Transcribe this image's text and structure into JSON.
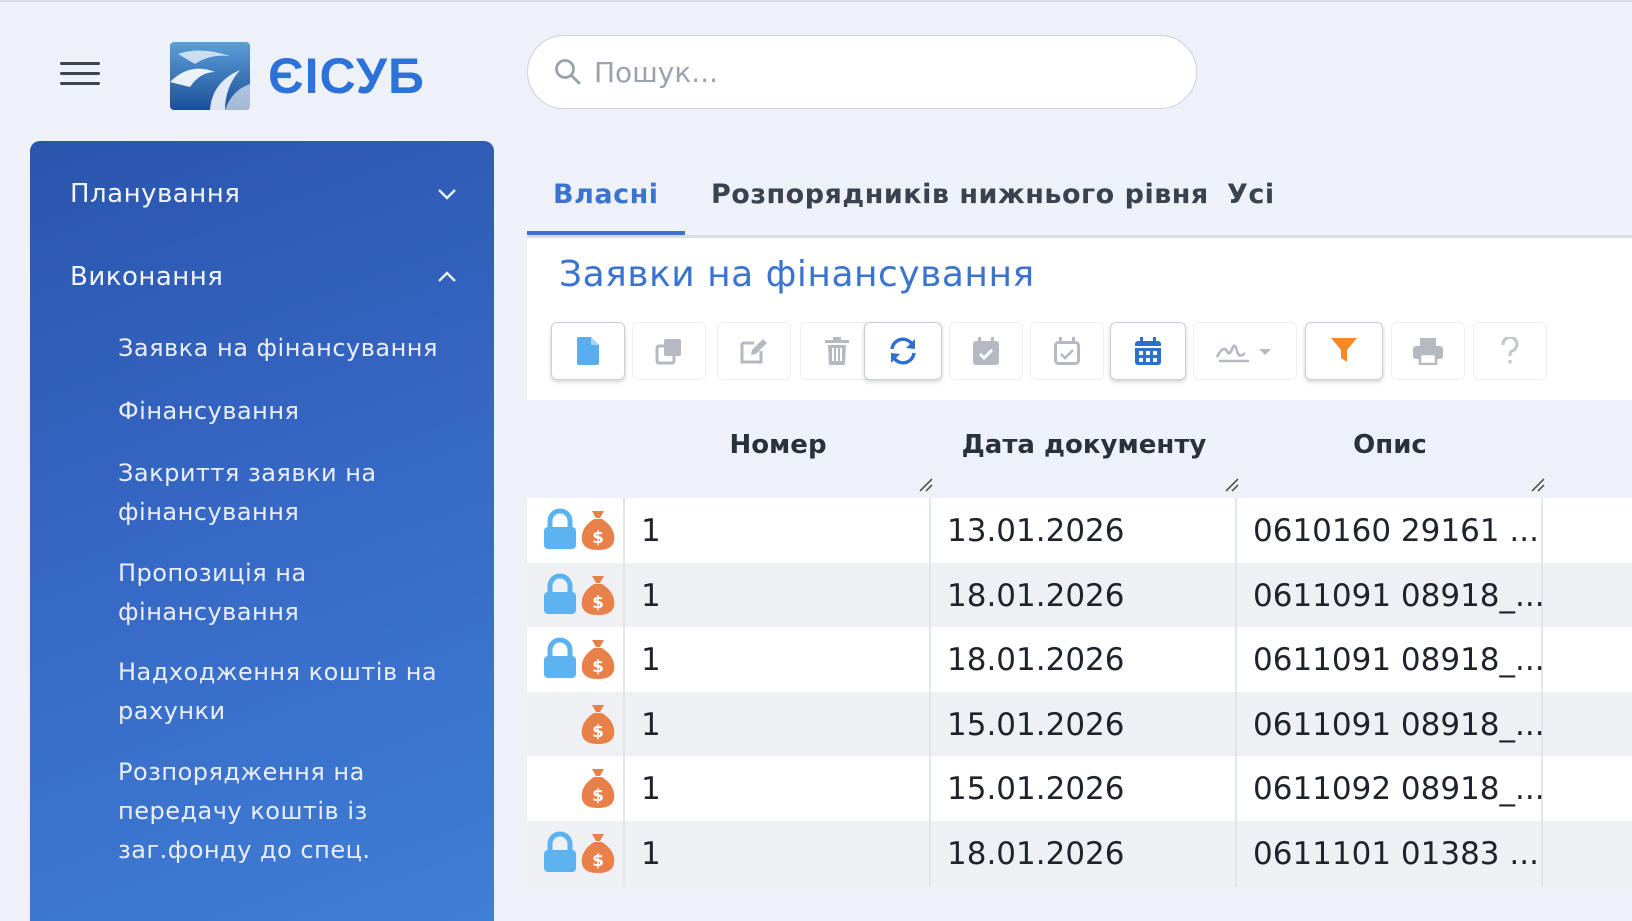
{
  "app": {
    "name": "ЄІСУБ"
  },
  "search": {
    "placeholder": "Пошук..."
  },
  "sidebar": {
    "sections": [
      {
        "label": "Планування",
        "expanded": false
      },
      {
        "label": "Виконання",
        "expanded": true
      }
    ],
    "items": [
      "Заявка на фінансування",
      "Фінансування",
      "Закриття заявки на фінансування",
      "Пропозиція на фінансування",
      "Надходження коштів на рахунки",
      "Розпорядження на передачу коштів із заг.фонду до спец."
    ]
  },
  "tabs": [
    {
      "label": "Власні",
      "active": true
    },
    {
      "label": "Розпорядників нижнього рівня",
      "active": false
    },
    {
      "label": "Усі",
      "active": false
    }
  ],
  "panel": {
    "title": "Заявки на фінансування"
  },
  "toolbar": [
    {
      "icon": "new-document-icon",
      "raised": true
    },
    {
      "icon": "copy-icon",
      "raised": false
    },
    {
      "icon": "edit-icon",
      "raised": false
    },
    {
      "icon": "delete-icon",
      "raised": false
    },
    {
      "icon": "refresh-icon",
      "raised": true
    },
    {
      "icon": "calendar-check-icon",
      "raised": false
    },
    {
      "icon": "calendar-check-outline-icon",
      "raised": false
    },
    {
      "icon": "calendar-icon",
      "raised": true
    },
    {
      "icon": "signature-icon",
      "raised": false
    },
    {
      "icon": "filter-icon",
      "raised": true
    },
    {
      "icon": "print-icon",
      "raised": false
    },
    {
      "icon": "help-icon",
      "raised": false
    }
  ],
  "table": {
    "columns": [
      "Номер",
      "Дата документу",
      "Опис"
    ],
    "rows": [
      {
        "locked": true,
        "money": true,
        "number": "1",
        "date": "13.01.2026",
        "desc": "0610160 29161 ..."
      },
      {
        "locked": true,
        "money": true,
        "number": "1",
        "date": "18.01.2026",
        "desc": "0611091 08918_..."
      },
      {
        "locked": true,
        "money": true,
        "number": "1",
        "date": "18.01.2026",
        "desc": "0611091 08918_..."
      },
      {
        "locked": false,
        "money": true,
        "number": "1",
        "date": "15.01.2026",
        "desc": "0611091 08918_..."
      },
      {
        "locked": false,
        "money": true,
        "number": "1",
        "date": "15.01.2026",
        "desc": "0611092 08918_..."
      },
      {
        "locked": true,
        "money": true,
        "number": "1",
        "date": "18.01.2026",
        "desc": "0611101 01383 ..."
      }
    ]
  },
  "colors": {
    "accent": "#3a74cf",
    "lock": "#5db3ef",
    "money": "#e8804a",
    "filter": "#f58a2a"
  }
}
